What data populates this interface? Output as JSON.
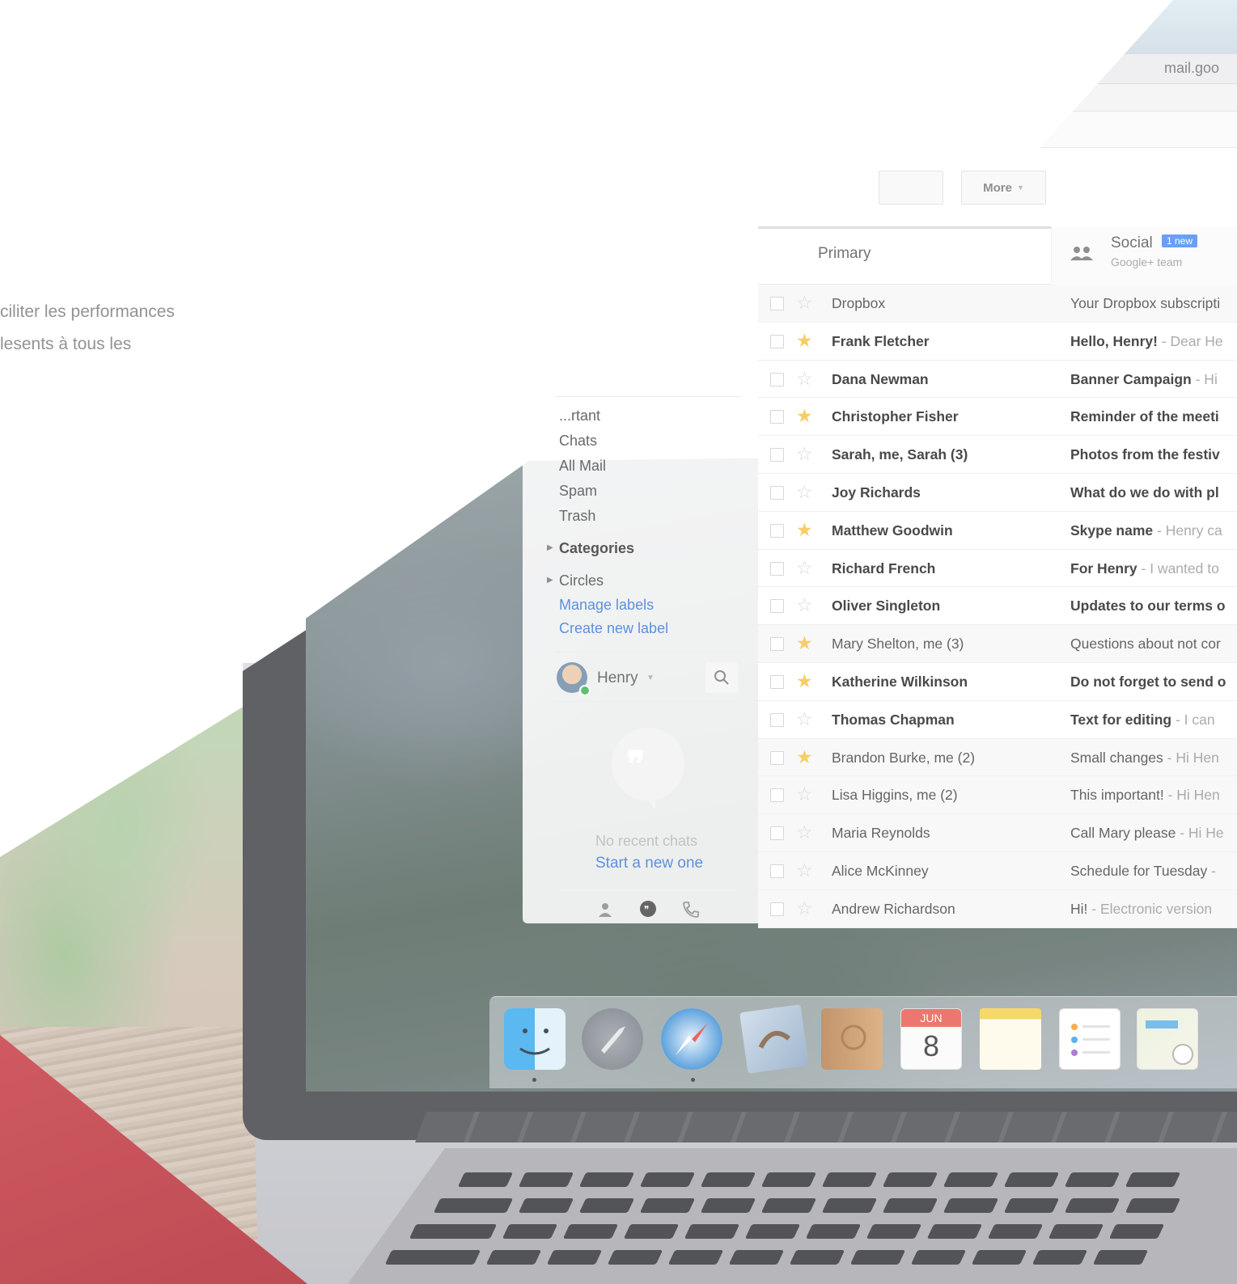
{
  "intro": {
    "line1": "ciliter les performances",
    "line2": "lesents à tous les"
  },
  "browser": {
    "url": "mail.goo"
  },
  "toolbar": {
    "more_label": "More"
  },
  "tabs": {
    "primary": "Primary",
    "social": {
      "label": "Social",
      "badge": "1 new",
      "subtitle": "Google+ team"
    }
  },
  "nav": {
    "items": [
      {
        "label": "...rtant"
      },
      {
        "label": "Chats"
      },
      {
        "label": "All Mail"
      },
      {
        "label": "Spam"
      },
      {
        "label": "Trash"
      }
    ],
    "categories": "Categories",
    "circles": "Circles",
    "manage_labels": "Manage labels",
    "create_label": "Create new label"
  },
  "chat": {
    "user_name": "Henry",
    "no_recent": "No recent chats",
    "start_new": "Start a new one"
  },
  "emails": [
    {
      "sender": "Dropbox",
      "subject": "Your Dropbox subscripti",
      "snippet": "",
      "starred": false,
      "unread": false
    },
    {
      "sender": "Frank Fletcher",
      "subject": "Hello, Henry!",
      "snippet": " - Dear He",
      "starred": true,
      "unread": true
    },
    {
      "sender": "Dana Newman",
      "subject": "Banner Campaign",
      "snippet": " - Hi",
      "starred": false,
      "unread": true
    },
    {
      "sender": "Christopher Fisher",
      "subject": "Reminder of the meeti",
      "snippet": "",
      "starred": true,
      "unread": true
    },
    {
      "sender": "Sarah, me, ",
      "sender_bold": "Sarah (3)",
      "subject": "Photos from the festiv",
      "snippet": "",
      "starred": false,
      "unread": true
    },
    {
      "sender": "Joy Richards",
      "subject": "What do we do with pl",
      "snippet": "",
      "starred": false,
      "unread": true
    },
    {
      "sender": "Matthew Goodwin",
      "subject": "Skype name",
      "snippet": " - Henry ca",
      "starred": true,
      "unread": true
    },
    {
      "sender": "Richard French",
      "subject": "For Henry",
      "snippet": " - I wanted to",
      "starred": false,
      "unread": true
    },
    {
      "sender": "Oliver Singleton",
      "subject": "Updates to our terms o",
      "snippet": "",
      "starred": false,
      "unread": true
    },
    {
      "sender": "Mary Shelton, me (3)",
      "subject": "Questions about not cor",
      "snippet": "",
      "starred": true,
      "unread": false
    },
    {
      "sender": "Katherine Wilkinson",
      "subject": "Do not forget to send o",
      "snippet": "",
      "starred": true,
      "unread": true
    },
    {
      "sender": "Thomas Chapman",
      "subject": "Text for editing",
      "snippet": " - I can",
      "starred": false,
      "unread": true
    },
    {
      "sender": "Brandon Burke, me (2)",
      "subject": "Small changes",
      "snippet": " - Hi Hen",
      "starred": true,
      "unread": false
    },
    {
      "sender": "Lisa Higgins, me (2)",
      "subject": "This important!",
      "snippet": " - Hi Hen",
      "starred": false,
      "unread": false
    },
    {
      "sender": "Maria Reynolds",
      "subject": "Call Mary please",
      "snippet": " - Hi He",
      "starred": false,
      "unread": false
    },
    {
      "sender": "Alice McKinney",
      "subject": "Schedule for Tuesday",
      "snippet": " -",
      "starred": false,
      "unread": false
    },
    {
      "sender": "Andrew Richardson",
      "subject": "Hi!",
      "snippet": " - Electronic version",
      "starred": false,
      "unread": false
    }
  ],
  "dock": {
    "calendar_month": "JUN",
    "calendar_day": "8",
    "icons": [
      "finder-icon",
      "launchpad-icon",
      "safari-icon",
      "mail-app-icon",
      "contacts-icon",
      "calendar-icon",
      "notes-icon",
      "reminders-icon",
      "maps-icon"
    ]
  },
  "colors": {
    "accent_link": "#3b78d8",
    "star_on": "#f6c344",
    "badge": "#4a8af4",
    "brand_red": "#b0242f"
  }
}
